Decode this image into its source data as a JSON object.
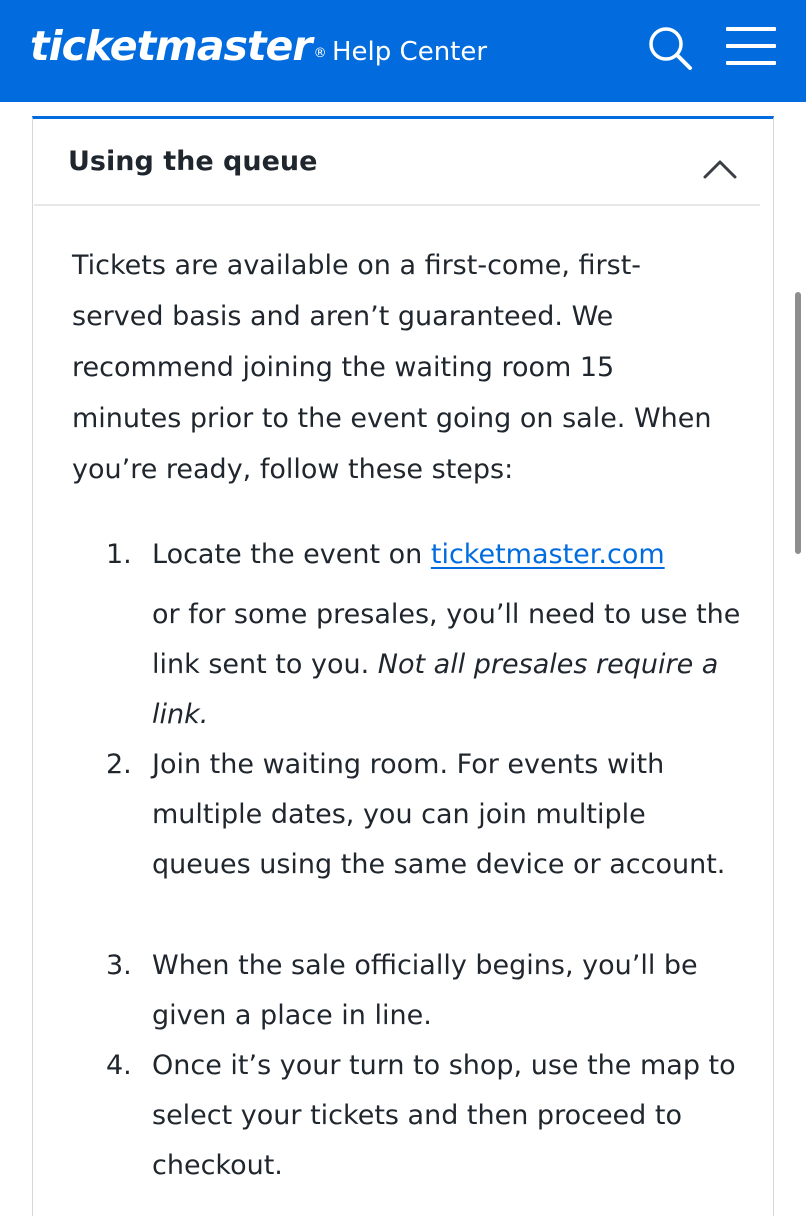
{
  "header": {
    "brand": "ticketmaster",
    "brand_mark": "®",
    "section": "Help Center",
    "search_icon": "search-icon",
    "menu_icon": "hamburger-menu-icon",
    "background_color": "#026cdf"
  },
  "accordion": {
    "title": "Using the queue",
    "expanded": true,
    "toggle_icon": "chevron-up-icon",
    "intro": "Tickets are available on a first-come, first-served basis and aren’t guaranteed. We recommend joining the waiting room 15 minutes prior to the event going on sale. When you’re ready, follow these steps:",
    "steps": [
      {
        "number": "1.",
        "prefix": "Locate the event on ",
        "link": "ticketmaster.com",
        "suffix": " or for some presales, you’ll need to use the link sent to you. ",
        "note": "Not all presales require a link."
      },
      {
        "number": "2.",
        "text": "Join the waiting room. For events with multiple dates, you can join multiple queues using the same device or account."
      },
      {
        "number": "3.",
        "text": "When the sale officially begins, you’ll be given a place in line."
      },
      {
        "number": "4.",
        "text": "Once it’s your turn to shop, use the map to select your tickets and then proceed to checkout."
      }
    ]
  },
  "colors": {
    "accent": "#026cdf",
    "text": "#1f262d",
    "border": "#d6d6d6"
  }
}
